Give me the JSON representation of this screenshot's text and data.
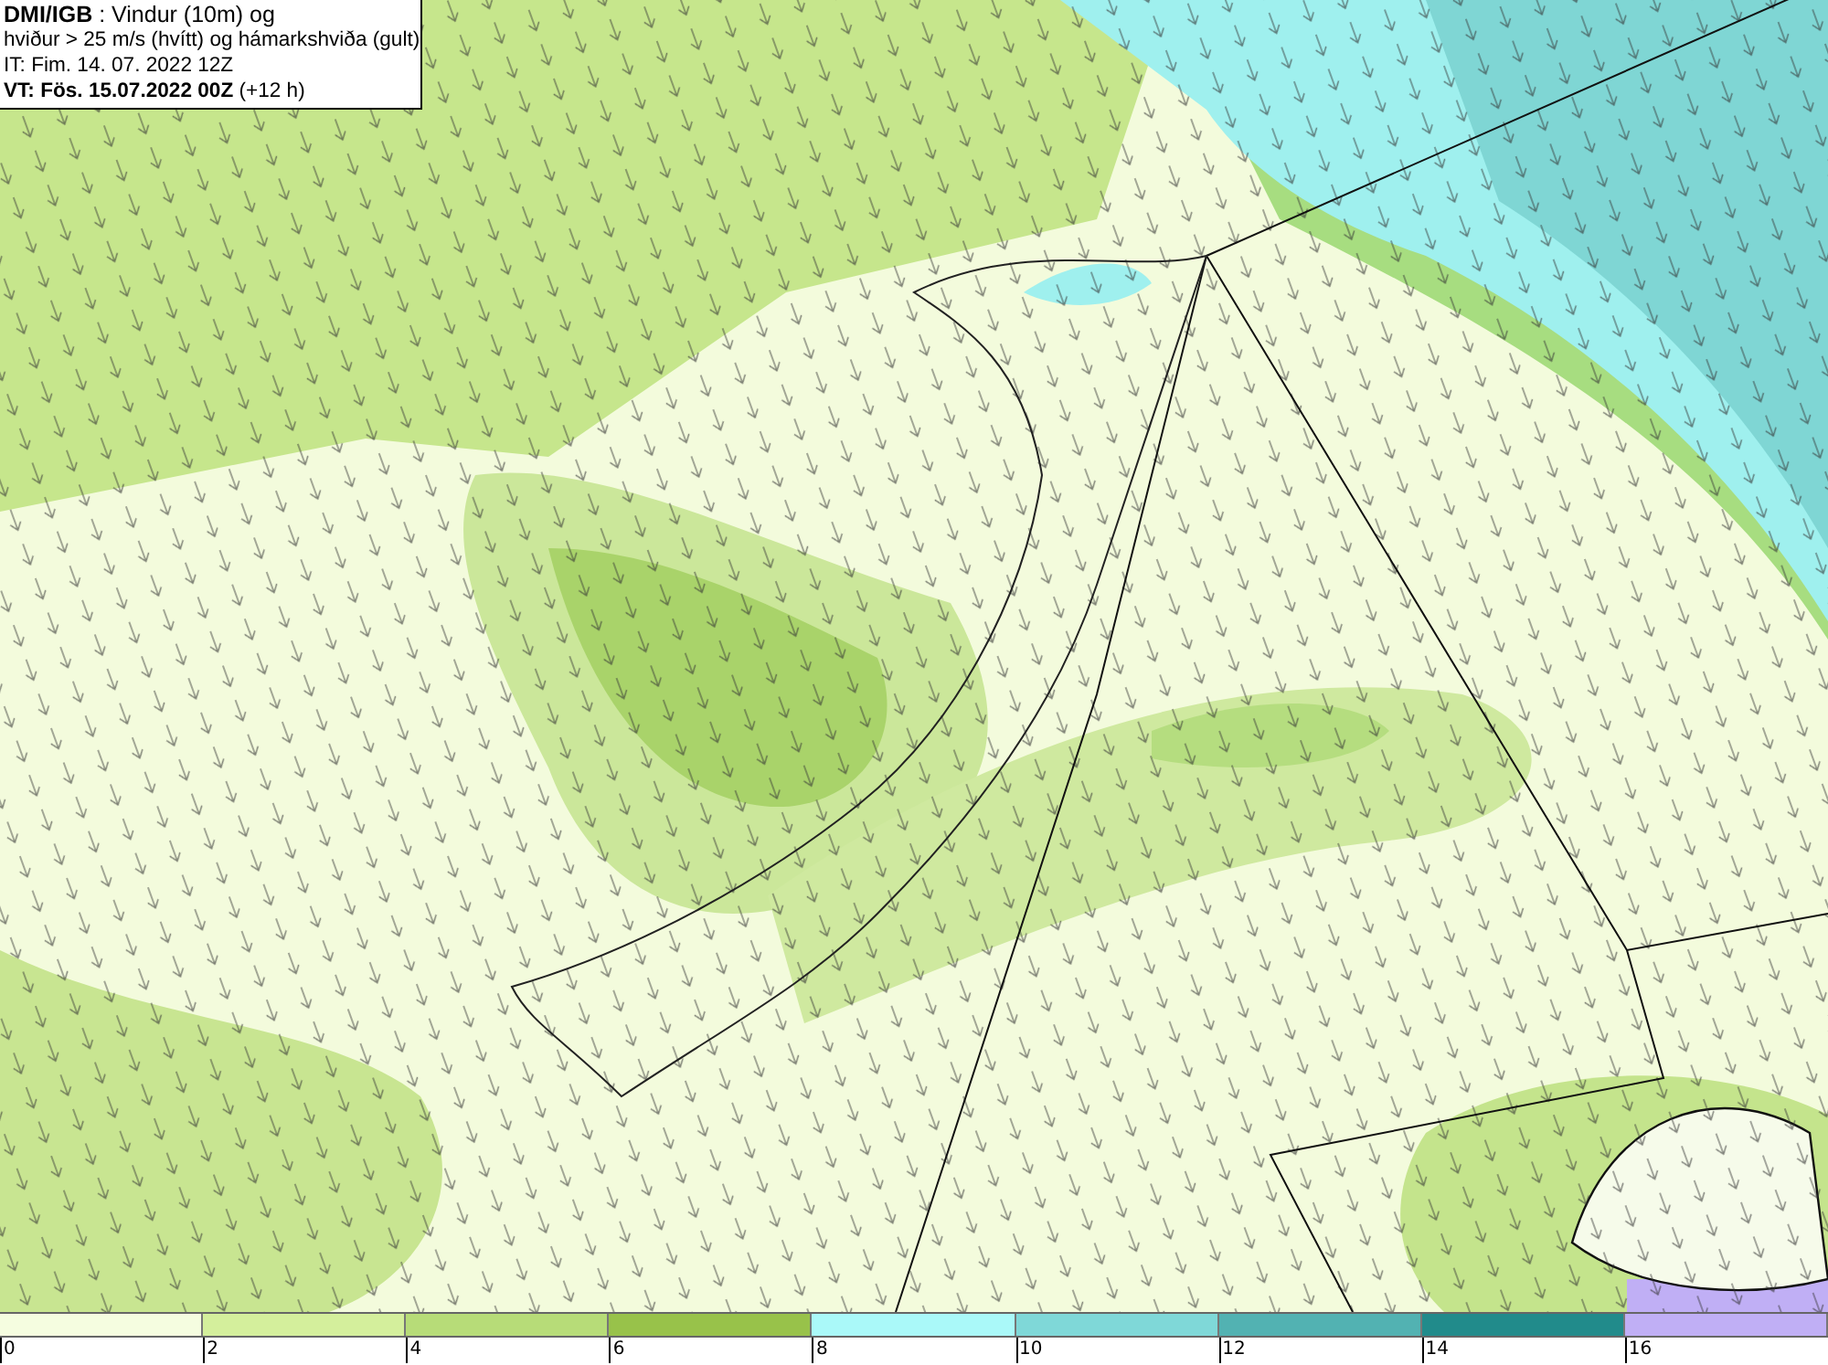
{
  "title_box": {
    "lines": [
      "**DMI/IGB** : Vindur (10m) og",
      "hviður > 25 m/s (hvítt) og hámarkshviða (gult)",
      "IT: Fim. 14. 07. 2022 12Z",
      "**VT: Fös. 15.07.2022 00Z** (+12 h)"
    ]
  },
  "legend": {
    "bins": [
      {
        "color": "#f5fde0"
      },
      {
        "color": "#d4ef9c"
      },
      {
        "color": "#b7dc78"
      },
      {
        "color": "#98c24a"
      },
      {
        "color": "#aaf9f9"
      },
      {
        "color": "#7fd8d8"
      },
      {
        "color": "#52b2b2"
      },
      {
        "color": "#218b8b"
      },
      {
        "color": "#c0aff5"
      }
    ],
    "ticks": [
      "0",
      "2",
      "4",
      "6",
      "8",
      "10",
      "12",
      "14",
      "16"
    ]
  }
}
